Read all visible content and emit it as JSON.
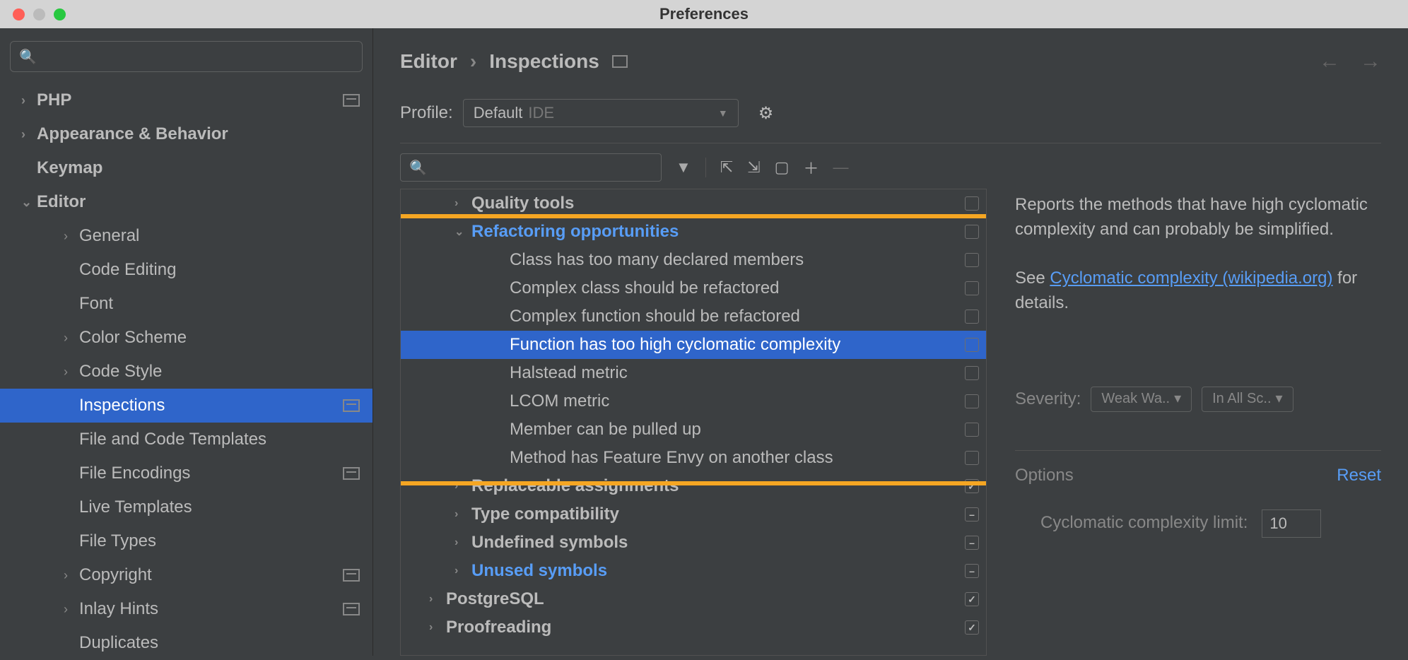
{
  "window": {
    "title": "Preferences"
  },
  "sidebar": {
    "items": [
      {
        "label": "PHP",
        "chevron": "›",
        "top": true,
        "badge": true
      },
      {
        "label": "Appearance & Behavior",
        "chevron": "›",
        "top": true
      },
      {
        "label": "Keymap",
        "chevron": "",
        "top": true
      },
      {
        "label": "Editor",
        "chevron": "⌄",
        "top": true
      },
      {
        "label": "General",
        "chevron": "›",
        "child": true
      },
      {
        "label": "Code Editing",
        "chevron": "",
        "child": true
      },
      {
        "label": "Font",
        "chevron": "",
        "child": true
      },
      {
        "label": "Color Scheme",
        "chevron": "›",
        "child": true
      },
      {
        "label": "Code Style",
        "chevron": "›",
        "child": true
      },
      {
        "label": "Inspections",
        "chevron": "",
        "child": true,
        "selected": true,
        "badge": true
      },
      {
        "label": "File and Code Templates",
        "chevron": "",
        "child": true
      },
      {
        "label": "File Encodings",
        "chevron": "",
        "child": true,
        "badge": true
      },
      {
        "label": "Live Templates",
        "chevron": "",
        "child": true
      },
      {
        "label": "File Types",
        "chevron": "",
        "child": true
      },
      {
        "label": "Copyright",
        "chevron": "›",
        "child": true,
        "badge": true
      },
      {
        "label": "Inlay Hints",
        "chevron": "›",
        "child": true,
        "badge": true
      },
      {
        "label": "Duplicates",
        "chevron": "",
        "child": true
      }
    ]
  },
  "breadcrumb": {
    "a": "Editor",
    "b": "Inspections"
  },
  "profile": {
    "label": "Profile:",
    "name": "Default",
    "suffix": "IDE"
  },
  "inspections": [
    {
      "label": "Quality tools",
      "chevron": "›",
      "indent": 2,
      "bold": true,
      "check": ""
    },
    {
      "label": "Refactoring opportunities",
      "chevron": "⌄",
      "indent": 2,
      "bold": true,
      "blue": true,
      "check": ""
    },
    {
      "label": "Class has too many declared members",
      "indent": 3,
      "check": ""
    },
    {
      "label": "Complex class should be refactored",
      "indent": 3,
      "check": ""
    },
    {
      "label": "Complex function should be refactored",
      "indent": 3,
      "check": ""
    },
    {
      "label": "Function has too high cyclomatic complexity",
      "indent": 3,
      "selected": true,
      "check": ""
    },
    {
      "label": "Halstead metric",
      "indent": 3,
      "check": ""
    },
    {
      "label": "LCOM metric",
      "indent": 3,
      "check": ""
    },
    {
      "label": "Member can be pulled up",
      "indent": 3,
      "check": ""
    },
    {
      "label": "Method has Feature Envy on another class",
      "indent": 3,
      "check": ""
    },
    {
      "label": "Replaceable assignments",
      "chevron": "›",
      "indent": 2,
      "bold": true,
      "check": "checked"
    },
    {
      "label": "Type compatibility",
      "chevron": "›",
      "indent": 2,
      "bold": true,
      "check": "mixed"
    },
    {
      "label": "Undefined symbols",
      "chevron": "›",
      "indent": 2,
      "bold": true,
      "check": "mixed"
    },
    {
      "label": "Unused symbols",
      "chevron": "›",
      "indent": 2,
      "bold": true,
      "blue": true,
      "check": "mixed"
    },
    {
      "label": "PostgreSQL",
      "chevron": "›",
      "indent": 1,
      "bold": true,
      "check": "checked"
    },
    {
      "label": "Proofreading",
      "chevron": "›",
      "indent": 1,
      "bold": true,
      "check": "checked"
    }
  ],
  "details": {
    "desc": "Reports the methods that have high cyclomatic complexity and can probably be simplified.",
    "see": "See ",
    "link": "Cyclomatic complexity (wikipedia.org)",
    "see2": " for details."
  },
  "severity": {
    "label": "Severity:",
    "btn1": "Weak Wa..",
    "btn2": "In All Sc.."
  },
  "options": {
    "label": "Options",
    "reset": "Reset",
    "field": "Cyclomatic complexity limit:",
    "value": "10"
  }
}
